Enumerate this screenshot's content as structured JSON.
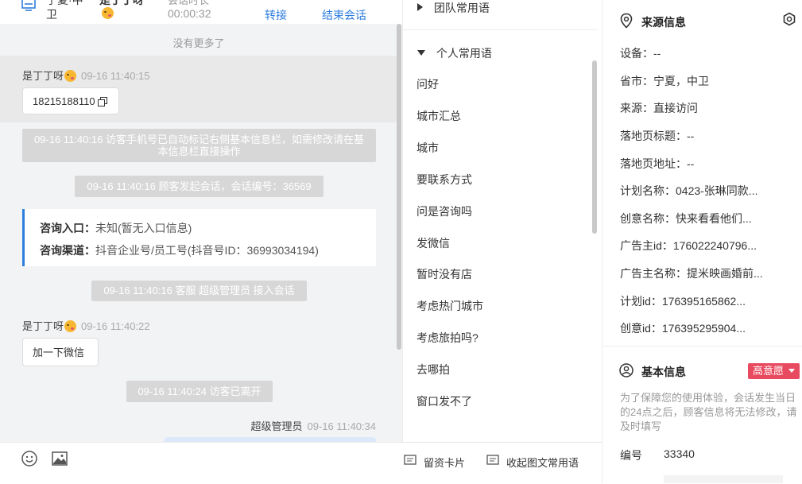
{
  "header": {
    "customer_prefix": "宁夏·中",
    "customer_second_line": "卫",
    "visitor_name_cut": "是丁丁呀",
    "duration_label_cut": "会话时长",
    "duration": "00:00:32",
    "transfer_label": "转接",
    "end_label": "结束会话"
  },
  "chat": {
    "no_more": "没有更多了",
    "messages": [
      {
        "name": "是丁丁呀",
        "time": "09-16 11:40:15",
        "text": "18215188110"
      },
      {
        "system": "09-16 11:40:16 访客手机号已自动标记右侧基本信息栏，如需修改请在基本信息栏直接操作"
      },
      {
        "system": "09-16 11:40:16 顾客发起会话，会话编号：36569"
      },
      {
        "system": "09-16 11:40:16 客服 超级管理员 接入会话"
      },
      {
        "name": "是丁丁呀",
        "time": "09-16 11:40:22",
        "text": "加一下微信"
      },
      {
        "system": "09-16 11:40:24 访客已离开"
      },
      {
        "name": "超级管理员",
        "time": "09-16 11:40:34"
      }
    ],
    "card": {
      "entry_label": "咨询入口：",
      "entry_value": "未知(暂无入口信息)",
      "channel_label": "咨询渠道：",
      "channel_value": "抖音企业号/员工号(抖音号ID：36993034194)"
    }
  },
  "toolbar": {
    "emoji_icon": "smile-icon",
    "image_icon": "image-icon",
    "card_label": "留资卡片",
    "phrases_label": "收起图文常用语"
  },
  "phrases": {
    "team_group": "团队常用语",
    "personal_group": "个人常用语",
    "items": [
      "问好",
      "城市汇总",
      "城市",
      "要联系方式",
      "问是咨询吗",
      "发微信",
      "暂时没有店",
      "考虑热门城市",
      "考虑旅拍吗?",
      "去哪拍",
      "窗口发不了"
    ]
  },
  "source": {
    "title": "来源信息",
    "lines": [
      "设备：--",
      "省市：宁夏，中卫",
      "来源：直接访问",
      "落地页标题：--",
      "落地页地址：--",
      "计划名称：0423-张琳同款...",
      "创意名称：快来看看他们...",
      "广告主id：176022240796...",
      "广告主名称：提米映画婚前...",
      "计划id：176395165862...",
      "创意id：176395295904..."
    ]
  },
  "basic": {
    "title": "基本信息",
    "badge": "高意愿",
    "tip": "为了保障您的使用体验，会话发生当日的24点之后，顾客信息将无法修改，请及时填写",
    "id_label": "编号",
    "id_value": "33340"
  },
  "colors": {
    "accent_blue": "#2d7ddf",
    "badge_red": "#e84a5f",
    "system_msg_bg": "#d7d7d7",
    "chat_bg": "#f2f3f5"
  }
}
